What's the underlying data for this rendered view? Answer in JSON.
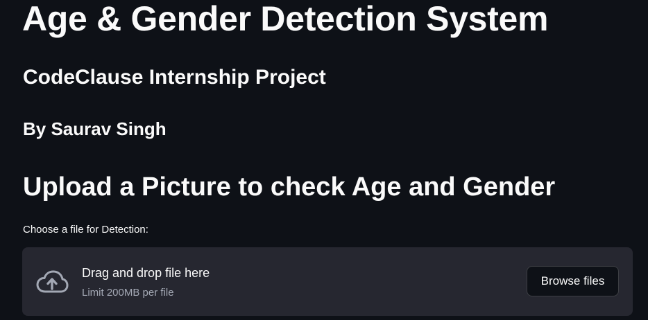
{
  "header": {
    "title": "Age & Gender Detection System",
    "subtitle": "CodeClause Internship Project",
    "author": "By Saurav Singh"
  },
  "main": {
    "upload_heading": "Upload a Picture to check Age and Gender",
    "uploader": {
      "label": "Choose a file for Detection:",
      "icon": "cloud-upload-icon",
      "drop_text": "Drag and drop file here",
      "limit_text": "Limit 200MB per file",
      "browse_label": "Browse files"
    }
  },
  "colors": {
    "background": "#0e1117",
    "dropzone": "#262730",
    "text": "#fafafa",
    "muted_text": "#a3a8b4"
  }
}
